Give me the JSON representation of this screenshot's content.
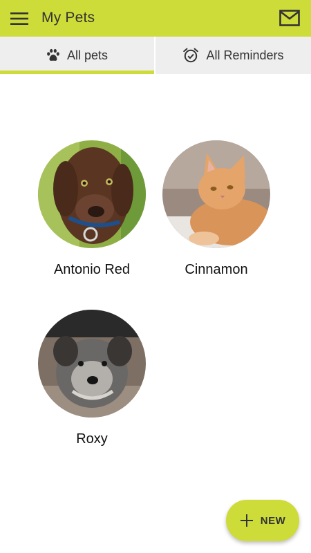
{
  "appbar": {
    "title": "My Pets",
    "menu_icon": "hamburger-menu-icon",
    "mail_icon": "mail-icon",
    "color": "#cddc39"
  },
  "tabs": [
    {
      "label": "All pets",
      "icon": "paw-icon",
      "selected": true
    },
    {
      "label": "All Reminders",
      "icon": "alarm-check-icon",
      "selected": false
    }
  ],
  "pets": [
    {
      "name": "Antonio Red"
    },
    {
      "name": "Cinnamon"
    },
    {
      "name": "Roxy"
    }
  ],
  "fab": {
    "label": "NEW",
    "icon": "plus-icon"
  }
}
